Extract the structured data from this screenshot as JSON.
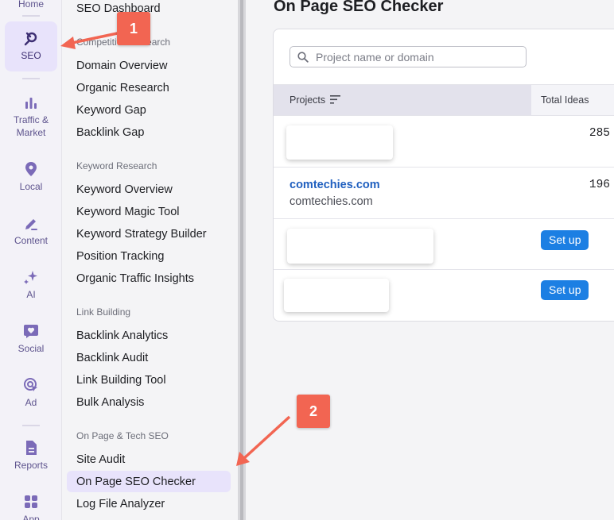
{
  "rail": {
    "home": "Home",
    "seo": "SEO",
    "traffic": "Traffic &\nMarket",
    "traffic_line1": "Traffic &",
    "traffic_line2": "Market",
    "local": "Local",
    "content": "Content",
    "ai": "AI",
    "social": "Social",
    "ad": "Ad",
    "reports": "Reports",
    "app": "App"
  },
  "subnav": {
    "dashboard": "SEO Dashboard",
    "competitive_heading": "Competitive Research",
    "competitive": [
      "Domain Overview",
      "Organic Research",
      "Keyword Gap",
      "Backlink Gap"
    ],
    "keyword_heading": "Keyword Research",
    "keyword": [
      "Keyword Overview",
      "Keyword Magic Tool",
      "Keyword Strategy Builder",
      "Position Tracking",
      "Organic Traffic Insights"
    ],
    "link_heading": "Link Building",
    "link": [
      "Backlink Analytics",
      "Backlink Audit",
      "Link Building Tool",
      "Bulk Analysis"
    ],
    "onpage_heading": "On Page & Tech SEO",
    "onpage": [
      "Site Audit",
      "On Page SEO Checker",
      "Log File Analyzer"
    ]
  },
  "main": {
    "title": "On Page SEO Checker",
    "search_placeholder": "Project name or domain",
    "col_projects": "Projects",
    "col_total_ideas": "Total Ideas",
    "rows": [
      {
        "count": "285"
      },
      {
        "name": "comtechies.com",
        "domain": "comtechies.com",
        "count": "196"
      },
      {
        "action": "Set up"
      },
      {
        "action": "Set up"
      }
    ]
  },
  "annotations": {
    "badge1": "1",
    "badge2": "2"
  },
  "colors": {
    "accent": "#e8e3fb",
    "link": "#1f5fbf",
    "button": "#1c7fe3",
    "badge": "#f26552"
  }
}
